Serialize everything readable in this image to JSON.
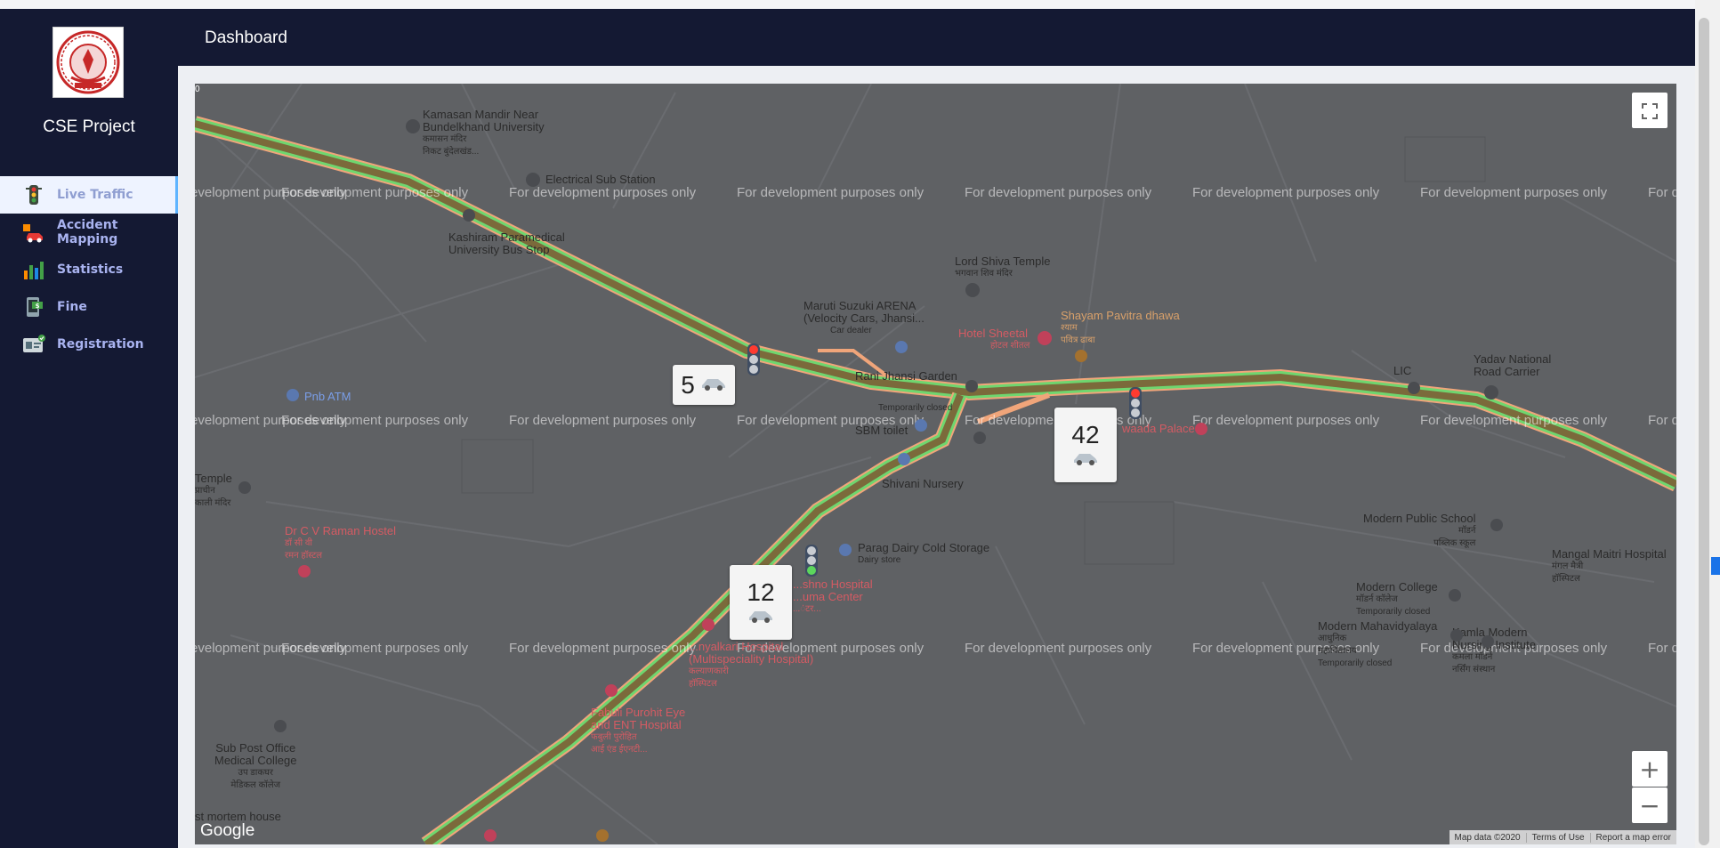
{
  "app": {
    "brand": "CSE Project",
    "logo_icon": "university-seal-icon"
  },
  "sidebar": {
    "items": [
      {
        "label": "Live Traffic",
        "icon": "traffic-light-icon",
        "active": true
      },
      {
        "label": "Accident Mapping",
        "icon": "car-crash-icon",
        "active": false
      },
      {
        "label": "Statistics",
        "icon": "bar-chart-icon",
        "active": false
      },
      {
        "label": "Fine",
        "icon": "mobile-payment-icon",
        "active": false
      },
      {
        "label": "Registration",
        "icon": "id-card-icon",
        "active": false
      }
    ]
  },
  "header": {
    "title": "Dashboard"
  },
  "map": {
    "watermark": "For development purposes only",
    "google_logo": "Google",
    "footer": {
      "map_data": "Map data ©2020",
      "terms": "Terms of Use",
      "report": "Report a map error"
    },
    "controls": {
      "fullscreen_icon": "fullscreen-icon",
      "zoom_in": "+",
      "zoom_out": "−"
    },
    "counters": [
      {
        "count": "5",
        "icon": "car-icon"
      },
      {
        "count": "42",
        "icon": "car-icon"
      },
      {
        "count": "12",
        "icon": "car-icon"
      }
    ],
    "traffic_lights": [
      {
        "state": "red"
      },
      {
        "state": "red"
      },
      {
        "state": "green"
      }
    ],
    "pois": {
      "kamasan": [
        "Kamasan Mandir Near",
        "Bundelkhand University",
        "कमासन मंदिर",
        "निकट बुंदेलखंड..."
      ],
      "electrical": "Electrical Sub Station",
      "kashiram": [
        "Kashiram Paramedical",
        "University Bus Stop"
      ],
      "lord_shiva": [
        "Lord Shiva Temple",
        "भगवान शिव मंदिर"
      ],
      "maruti": [
        "Maruti Suzuki ARENA",
        "(Velocity Cars, Jhansi...",
        "Car dealer"
      ],
      "hotel_sheetal": [
        "Hotel Sheetal",
        "होटल शीतल"
      ],
      "shayam": [
        "Shayam Pavitra dhawa",
        "श्याम",
        "पवित्र ढाबा"
      ],
      "rani": "Rani Jhansi Garden",
      "temp_closed": "Temporarily closed",
      "sbm": "SBM toilet",
      "pnb": "Pnb ATM",
      "lic": "LIC",
      "yadav": [
        "Yadav National",
        "Road Carrier"
      ],
      "palace": "waada Palace",
      "temple": [
        "Temple",
        "प्राचीन",
        "काली मंदिर"
      ],
      "shivani": "Shivani Nursery",
      "raman": [
        "Dr C V Raman Hostel",
        "डॉ सी वी",
        "रमन हॉस्टल"
      ],
      "parag": [
        "Parag Dairy Cold Storage",
        "Dairy store"
      ],
      "modern_public": [
        "Modern Public School",
        "मॉडर्न",
        "पब्लिक स्कूल"
      ],
      "mangal": [
        "Mangal Maitri Hospital",
        "मंगल मैत्री",
        "हॉस्पिटल"
      ],
      "hospital_a": [
        "...shno Hospital",
        "...uma Center",
        "...ंटर..."
      ],
      "modern_college": [
        "Modern College",
        "मॉडर्न कॉलेज",
        "Temporarily closed"
      ],
      "modern_maha": [
        "Modern Mahavidyalaya",
        "आधुनिक",
        "महाविद्यालय",
        "Temporarily closed"
      ],
      "kamla": [
        "Kamla Modern",
        "Nursing Institute",
        "कमला मॉडर्न",
        "नर्सिंग संस्थान"
      ],
      "hospital_multi": [
        "...nyalkari Hospital",
        "(Multispeciality Hospital)",
        "कल्याणकारी",
        "हॉस्पिटल"
      ],
      "fabuli": [
        "Fabuli Purohit Eye",
        "and ENT Hospital",
        "फबुली पुरोहित",
        "आई एंड ईएनटी..."
      ],
      "post_office": [
        "Sub Post Office",
        "Medical College",
        "उप डाकघर",
        "मेडिकल कॉलेज"
      ],
      "mortem": "st mortem house",
      "corner": "0"
    }
  }
}
